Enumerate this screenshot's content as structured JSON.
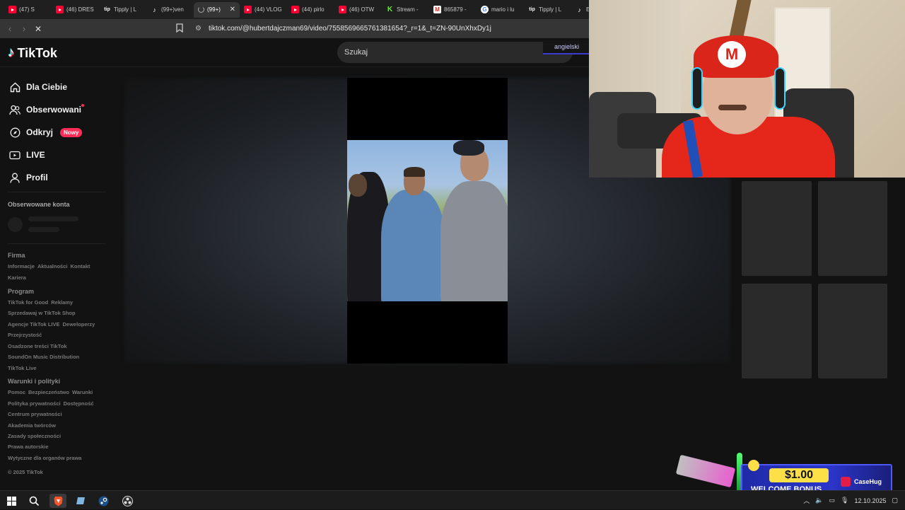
{
  "browser": {
    "tabs": [
      {
        "icon": "youtube-icon",
        "label": "(47) S"
      },
      {
        "icon": "youtube-icon",
        "label": "(46) DRES"
      },
      {
        "icon": "tipply-icon",
        "label": "Tipply | L"
      },
      {
        "icon": "tiktok-icon",
        "label": "(99+)ven"
      },
      {
        "icon": "loading-icon",
        "label": "(99+)",
        "active": true
      },
      {
        "icon": "youtube-icon",
        "label": "(44) VLOG"
      },
      {
        "icon": "youtube-icon",
        "label": "(44) pirlo"
      },
      {
        "icon": "youtube-icon",
        "label": "(46) OTW"
      },
      {
        "icon": "kick-icon",
        "label": "Stream -"
      },
      {
        "icon": "gmail-icon",
        "label": "865879 -"
      },
      {
        "icon": "google-icon",
        "label": "mario i lu"
      },
      {
        "icon": "tipply-icon",
        "label": "Tipply | L"
      },
      {
        "icon": "tiktok-icon",
        "label": "E"
      }
    ],
    "url": "tiktok.com/@hubertdajczman69/video/7558569665761381654?_r=1&_t=ZN-90UnXhxDy1j"
  },
  "tiktok": {
    "logo_text": "TikTok",
    "search_placeholder": "Szukaj",
    "language": "angielski",
    "nav": [
      {
        "icon": "home-icon",
        "label": "Dla Ciebie"
      },
      {
        "icon": "following-icon",
        "label": "Obserwowani"
      },
      {
        "icon": "explore-icon",
        "label": "Odkryj",
        "badge": "Nowy"
      },
      {
        "icon": "live-icon",
        "label": "LIVE"
      },
      {
        "icon": "profile-icon",
        "label": "Profil"
      }
    ],
    "followed_heading": "Obserwowane konta",
    "footer": {
      "firma_title": "Firma",
      "firma_links": [
        "Informacje",
        "Aktualności",
        "Kontakt"
      ],
      "kariera": "Kariera",
      "program_title": "Program",
      "program_lines": [
        [
          "TikTok for Good",
          "Reklamy"
        ],
        [
          "Sprzedawaj w TikTok Shop"
        ],
        [
          "Agencje TikTok LIVE",
          "Deweloperzy"
        ],
        [
          "Przejrzystość"
        ],
        [
          "Osadzone treści TikTok"
        ],
        [
          "SoundOn Music Distribution"
        ],
        [
          "TikTok Live"
        ]
      ],
      "terms_title": "Warunki i polityki",
      "terms_lines": [
        [
          "Pomoc",
          "Bezpieczeństwo",
          "Warunki"
        ],
        [
          "Polityka prywatności",
          "Dostępność"
        ],
        [
          "Centrum prywatności"
        ],
        [
          "Akademia twórców"
        ],
        [
          "Zasady społeczności"
        ],
        [
          "Prawa autorskie"
        ],
        [
          "Wytyczne dla organów prawa"
        ]
      ],
      "copyright": "© 2025 TikTok"
    }
  },
  "ad": {
    "price": "$1.00",
    "bonus": "WELCOME BONUS",
    "brand": "CaseHug"
  },
  "taskbar": {
    "date": "12.10.2025"
  },
  "colors": {
    "accent": "#fe2c55",
    "background": "#121212"
  }
}
